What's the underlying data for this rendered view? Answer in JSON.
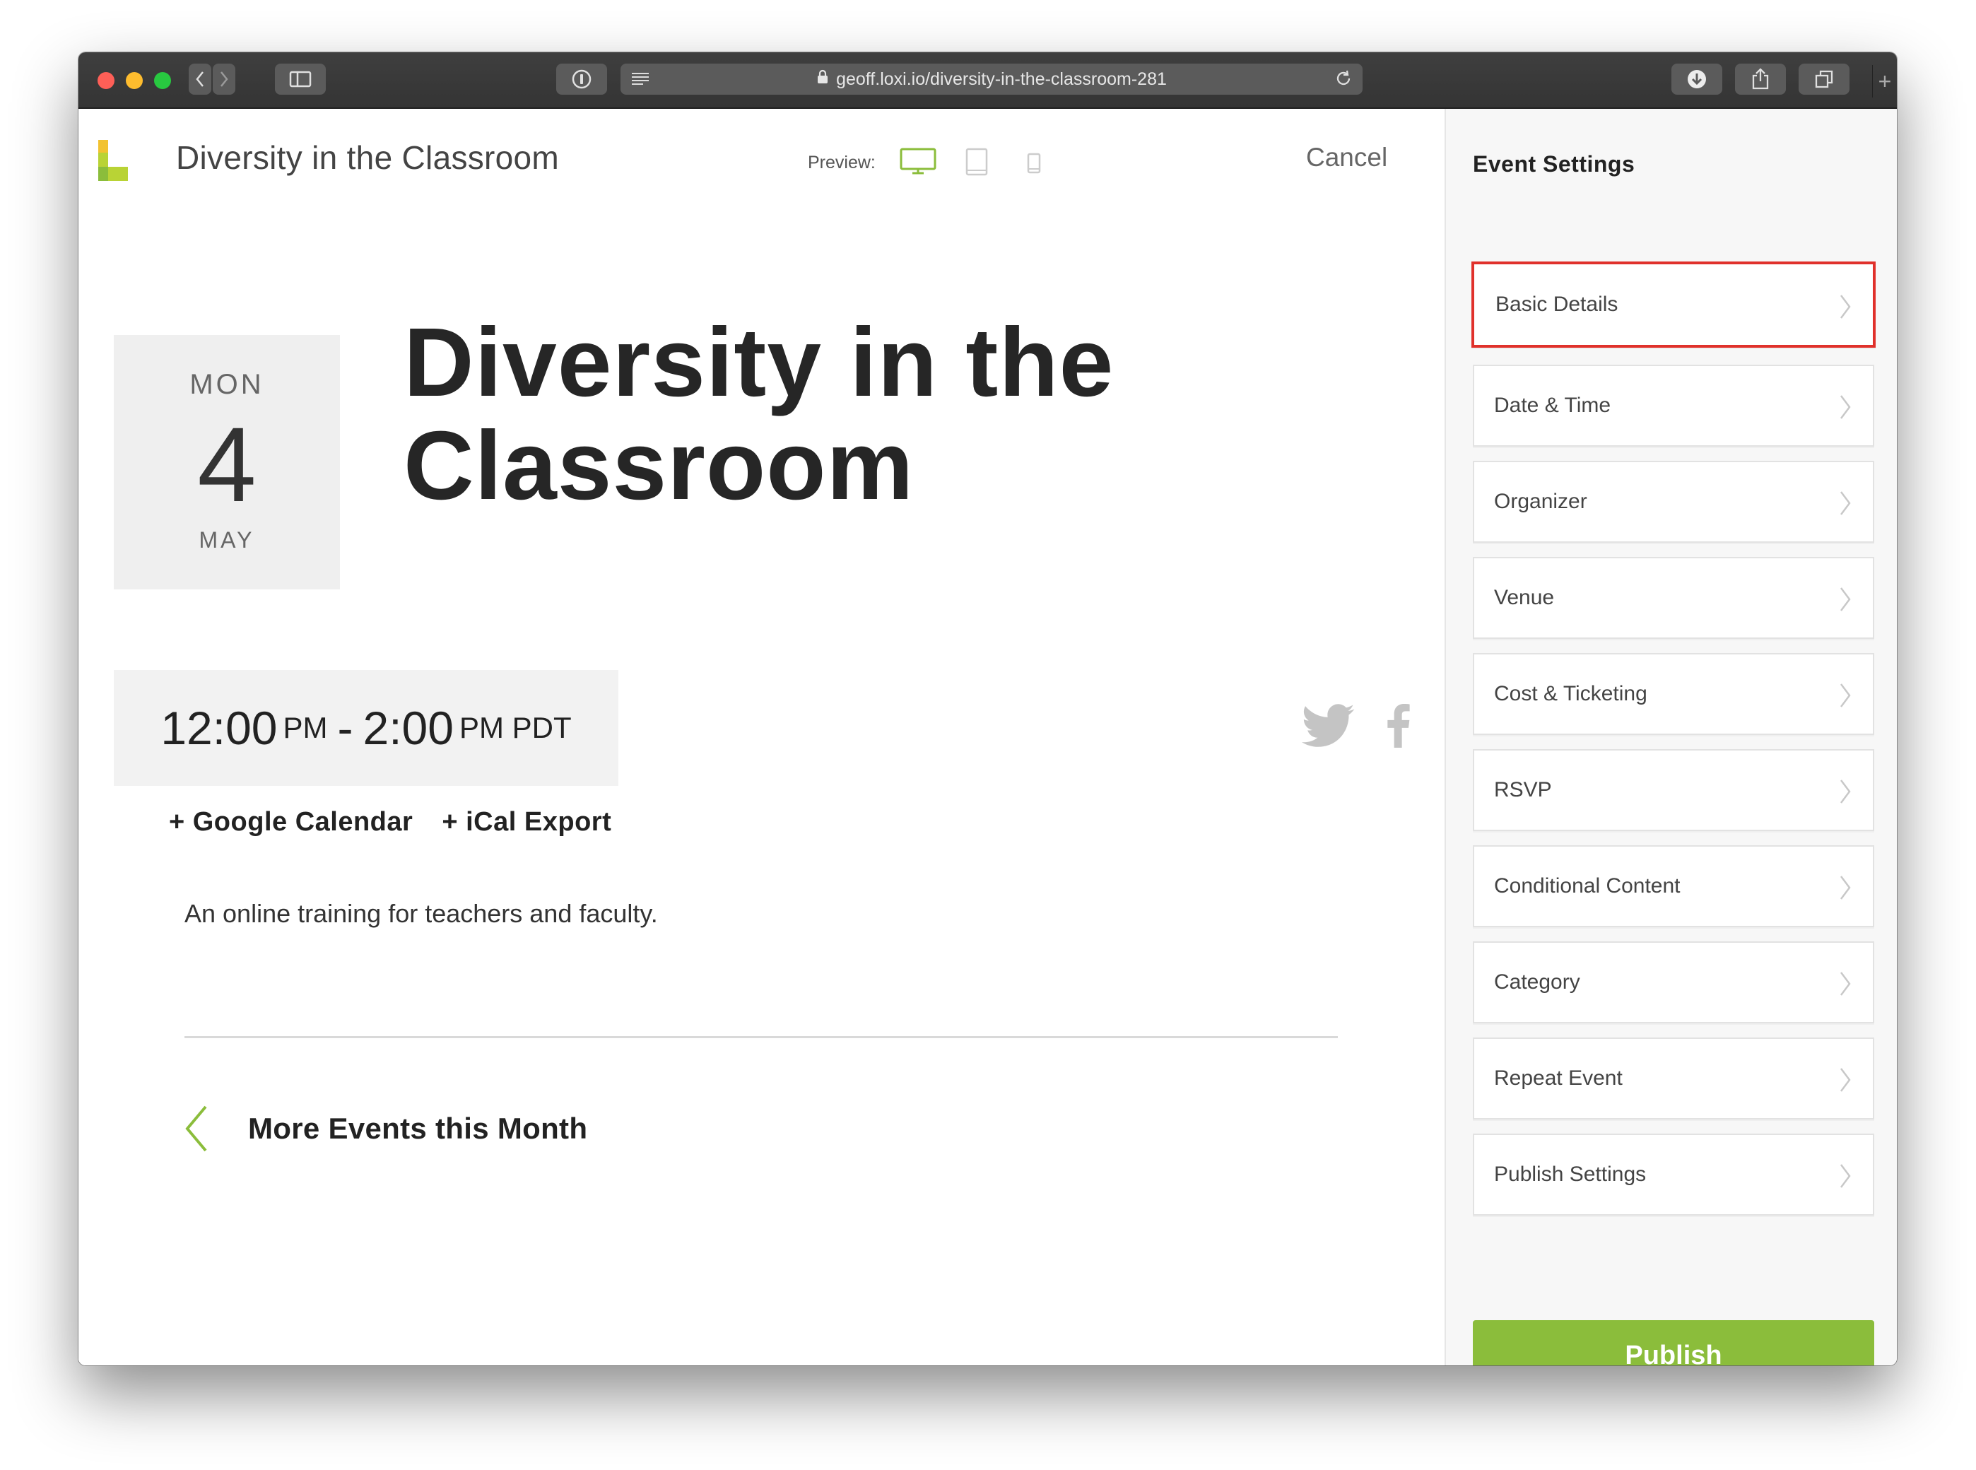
{
  "browser": {
    "url": "geoff.loxi.io/diversity-in-the-classroom-281"
  },
  "header": {
    "app_title": "Diversity in the Classroom",
    "preview_label": "Preview:",
    "cancel_label": "Cancel",
    "preview_devices": [
      "desktop-icon",
      "tablet-icon",
      "mobile-icon"
    ],
    "accent_color": "#8bbd3b"
  },
  "event": {
    "date": {
      "weekday": "MON",
      "day": "4",
      "month": "MAY"
    },
    "title": "Diversity in the Classroom",
    "time": {
      "start": "12:00",
      "start_ampm": "PM",
      "separator": "-",
      "end": "2:00",
      "end_ampm": "PM PDT"
    },
    "calendar_links": [
      "+ Google Calendar",
      "+ iCal Export"
    ],
    "description": "An online training for teachers and faculty.",
    "more_events_label": "More Events this Month"
  },
  "sidebar": {
    "title": "Event Settings",
    "items": [
      {
        "label": "Basic Details"
      },
      {
        "label": "Date & Time"
      },
      {
        "label": "Organizer"
      },
      {
        "label": "Venue"
      },
      {
        "label": "Cost & Ticketing"
      },
      {
        "label": "RSVP"
      },
      {
        "label": "Conditional Content"
      },
      {
        "label": "Category"
      },
      {
        "label": "Repeat Event"
      },
      {
        "label": "Publish Settings"
      }
    ],
    "publish_label": "Publish",
    "highlight_color": "#e0312b"
  }
}
